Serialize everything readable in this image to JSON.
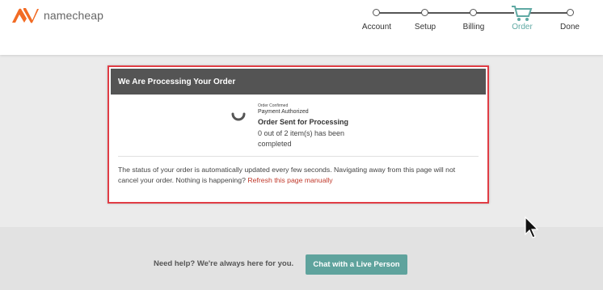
{
  "header": {
    "logo_text": "namecheap",
    "steps": [
      {
        "label": "Account",
        "active": false
      },
      {
        "label": "Setup",
        "active": false
      },
      {
        "label": "Billing",
        "active": false
      },
      {
        "label": "Order",
        "active": true
      },
      {
        "label": "Done",
        "active": false
      }
    ],
    "brand_color": "#f26b24",
    "active_step_color": "#5fa9a3"
  },
  "order_card": {
    "title": "We Are Processing Your Order",
    "status_tiny": "Order Confirmed",
    "status_paid": "Payment Authorized",
    "status_sent": "Order Sent for Processing",
    "count_text": "0 out of 2 item(s) has been completed",
    "status_message": "The status of your order is automatically updated every few seconds. Navigating away from this page will not cancel your order. Nothing is happening?",
    "refresh_link": "Refresh this page manually",
    "highlight_color": "#e03d45"
  },
  "help": {
    "text": "Need help? We're always here for you.",
    "chat_button": "Chat with a Live Person",
    "button_color": "#5fa39d"
  }
}
